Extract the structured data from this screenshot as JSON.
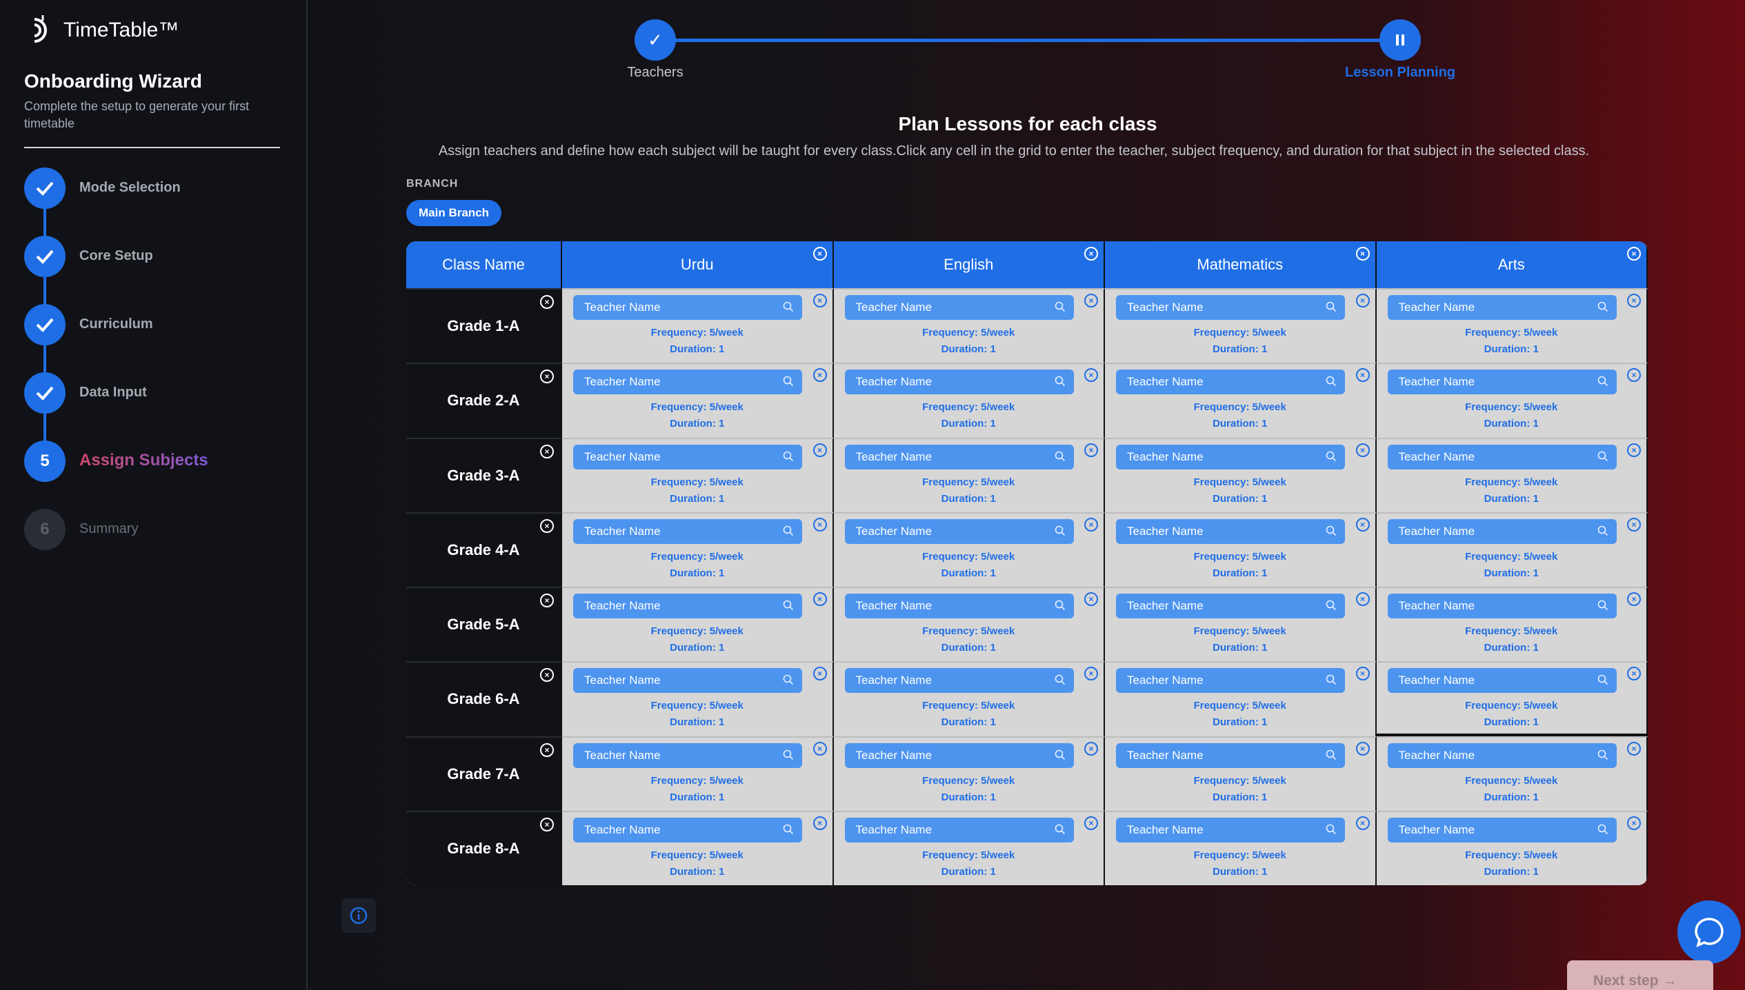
{
  "app": {
    "name": "TimeTable™"
  },
  "wizard": {
    "title": "Onboarding Wizard",
    "subtitle": "Complete the setup to generate your first timetable",
    "steps": [
      {
        "label": "Mode Selection",
        "state": "done"
      },
      {
        "label": "Core Setup",
        "state": "done"
      },
      {
        "label": "Curriculum",
        "state": "done"
      },
      {
        "label": "Data Input",
        "state": "done"
      },
      {
        "label": "Assign Subjects",
        "state": "active",
        "number": "5"
      },
      {
        "label": "Summary",
        "state": "inactive",
        "number": "6"
      }
    ]
  },
  "progress": {
    "steps": [
      {
        "label": "Teachers",
        "state": "done"
      },
      {
        "label": "Lesson Planning",
        "state": "current"
      }
    ]
  },
  "page": {
    "title": "Plan Lessons for each class",
    "subtitle": "Assign teachers and define how each subject will be taught for every class.Click any cell in the grid to enter the teacher, subject frequency, and duration for that subject in the selected class."
  },
  "branch": {
    "label": "BRANCH",
    "selected": "Main Branch"
  },
  "grid": {
    "class_header": "Class Name",
    "subjects": [
      "Urdu",
      "English",
      "Mathematics",
      "Arts"
    ],
    "classes": [
      "Grade 1-A",
      "Grade 2-A",
      "Grade 3-A",
      "Grade 4-A",
      "Grade 5-A",
      "Grade 6-A",
      "Grade 7-A",
      "Grade 8-A"
    ],
    "cell": {
      "teacher_placeholder": "Teacher Name",
      "frequency": "Frequency: 5/week",
      "duration": "Duration: 1"
    }
  },
  "actions": {
    "next_label": "Next step →"
  },
  "colors": {
    "accent": "#1f6ee6",
    "cell_bg": "#d6d6d6"
  }
}
